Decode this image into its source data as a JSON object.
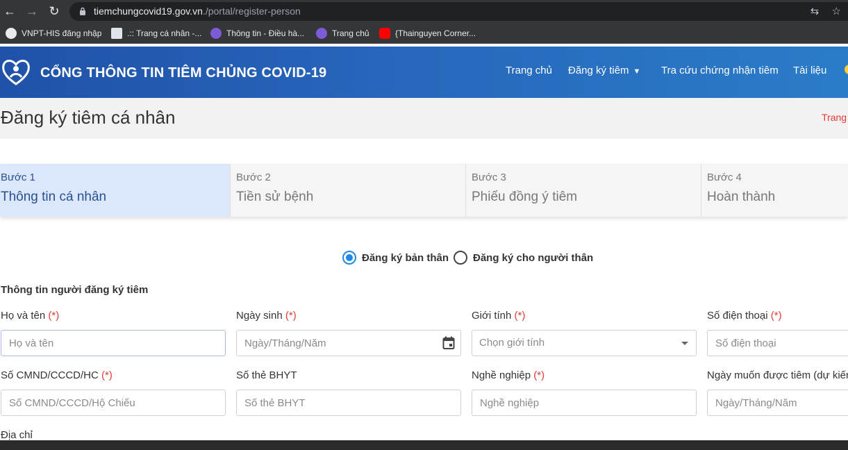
{
  "browser": {
    "url_host": "tiemchungcovid19.gov.vn",
    "url_path": "./portal/register-person",
    "bookmarks": [
      {
        "label": "VNPT-HIS đăng nhập",
        "icon": "github-icon"
      },
      {
        "label": ".:: Trang cá nhân -...",
        "icon": "page-icon"
      },
      {
        "label": "Thông tin - Điều hà...",
        "icon": "globe-icon"
      },
      {
        "label": "Trang chủ",
        "icon": "globe-icon"
      },
      {
        "label": "{Thainguyen Corner...",
        "icon": "youtube-icon"
      }
    ]
  },
  "header": {
    "site_title": "CỔNG THÔNG TIN TIÊM CHỦNG COVID-19",
    "nav": [
      "Trang chủ",
      "Đăng ký tiêm",
      "Tra cứu chứng nhận tiêm",
      "Tài liệu"
    ]
  },
  "page": {
    "title": "Đăng ký tiêm cá nhân",
    "breadcrumb": "Trang c"
  },
  "steps": [
    {
      "num": "Bước 1",
      "name": "Thông tin cá nhân",
      "active": true
    },
    {
      "num": "Bước 2",
      "name": "Tiền sử bệnh",
      "active": false
    },
    {
      "num": "Bước 3",
      "name": "Phiếu đồng ý tiêm",
      "active": false
    },
    {
      "num": "Bước 4",
      "name": "Hoàn thành",
      "active": false
    }
  ],
  "register_options": {
    "self": "Đăng ký bản thân",
    "relative": "Đăng ký cho người thân",
    "selected": "self"
  },
  "form": {
    "section_title": "Thông tin người đăng ký tiêm",
    "required_mark": "(*)",
    "fields": {
      "full_name": {
        "label": "Họ và tên",
        "placeholder": "Họ và tên"
      },
      "dob": {
        "label": "Ngày sinh",
        "placeholder": "Ngày/Tháng/Năm"
      },
      "gender": {
        "label": "Giới tính",
        "placeholder": "Chọn giới tính"
      },
      "phone": {
        "label": "Số điện thoại",
        "placeholder": "Số điện thoại"
      },
      "id_number": {
        "label": "Số CMND/CCCD/HC",
        "placeholder": "Số CMND/CCCD/Hộ Chiếu"
      },
      "insurance": {
        "label": "Số thẻ BHYT",
        "placeholder": "Số thẻ BHYT"
      },
      "occupation": {
        "label": "Nghề nghiệp",
        "placeholder": "Nghề nghiệp"
      },
      "desired_date": {
        "label": "Ngày muốn được tiêm (dự kiến",
        "placeholder": "Ngày/Tháng/Năm"
      },
      "address": {
        "label": "Địa chỉ"
      }
    }
  },
  "colors": {
    "header_blue": "#2766bb",
    "active_step_bg": "#dbe8fb",
    "active_step_text": "#2a4f8f",
    "required_red": "#e53935",
    "radio_blue": "#1e88e5"
  }
}
